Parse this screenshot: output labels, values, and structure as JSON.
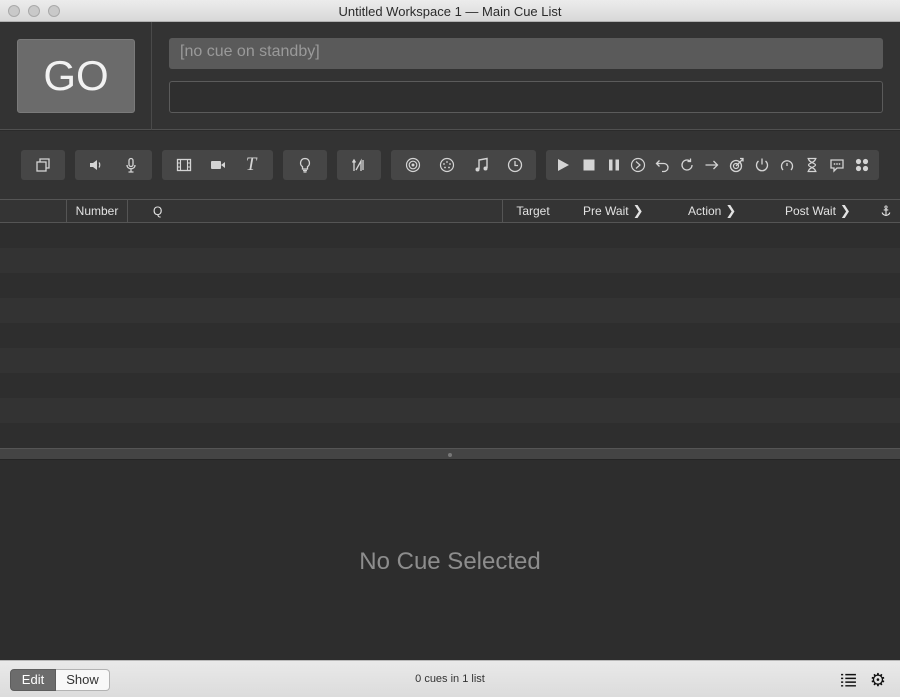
{
  "window": {
    "title": "Untitled Workspace 1 — Main Cue List"
  },
  "go": {
    "label": "GO"
  },
  "standby": {
    "text": "[no cue on standby]"
  },
  "notes": {
    "value": ""
  },
  "toolbar": {
    "icons": [
      "group-cue-icon",
      "audio-cue-icon",
      "mic-cue-icon",
      "video-cue-icon",
      "camera-cue-icon",
      "text-cue-icon",
      "light-cue-icon",
      "fade-cue-icon",
      "network-cue-icon",
      "midi-cue-icon",
      "midi-file-cue-icon",
      "timecode-cue-icon",
      "start-cue-icon",
      "stop-cue-icon",
      "pause-cue-icon",
      "load-cue-icon",
      "reset-cue-icon",
      "devamp-cue-icon",
      "goto-cue-icon",
      "target-cue-icon",
      "arm-cue-icon",
      "disarm-cue-icon",
      "wait-cue-icon",
      "memo-cue-icon",
      "script-cue-icon"
    ]
  },
  "columns": {
    "number": "Number",
    "q": "Q",
    "target": "Target",
    "pre_wait": "Pre Wait",
    "action": "Action",
    "post_wait": "Post Wait",
    "continue_icon": "anchor-icon"
  },
  "inspector": {
    "empty_text": "No Cue Selected"
  },
  "footer": {
    "edit_label": "Edit",
    "show_label": "Show",
    "status": "0 cues in 1 list",
    "list_icon": "list-icon",
    "settings_icon": "gear-icon"
  }
}
